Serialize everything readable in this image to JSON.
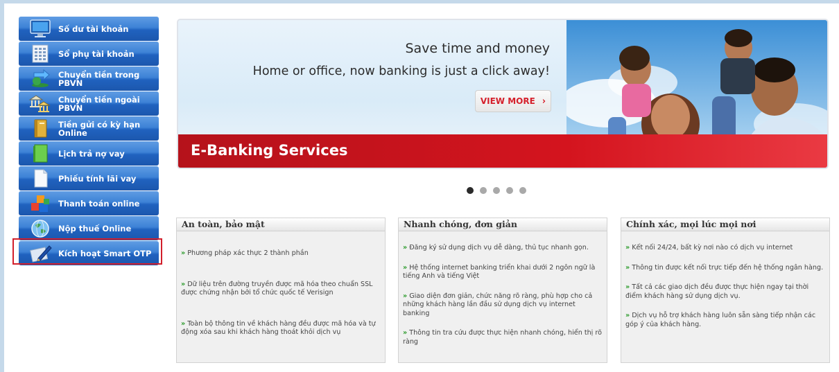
{
  "sidebar": {
    "items": [
      {
        "label": "Số dư tài khoản",
        "icon": "monitor-icon"
      },
      {
        "label": "Sổ phụ tài khoản",
        "icon": "ledger-icon"
      },
      {
        "label": "Chuyển tiền trong PBVN",
        "icon": "transfer-icon"
      },
      {
        "label": "Chuyển tiền ngoài PBVN",
        "icon": "bank-icon"
      },
      {
        "label": "Tiền gửi có kỳ hạn Online",
        "icon": "book-icon"
      },
      {
        "label": "Lịch trả nợ vay",
        "icon": "green-document-icon"
      },
      {
        "label": "Phiếu tính lãi vay",
        "icon": "blank-document-icon"
      },
      {
        "label": "Thanh toán online",
        "icon": "blocks-icon"
      },
      {
        "label": "Nộp thuế Online",
        "icon": "globe-icon"
      },
      {
        "label": "Kích hoạt Smart OTP",
        "icon": "pen-icon"
      }
    ]
  },
  "banner": {
    "headline": "Save time and money",
    "subline": "Home or office, now banking is just a click away!",
    "cta": "VIEW MORE",
    "cta_arrow": "›",
    "section_title": "E-Banking Services"
  },
  "pager": {
    "count": 5,
    "active": 1
  },
  "boxes": [
    {
      "title": "An toàn, bảo mật",
      "items": [
        "Phương pháp xác thực 2 thành phần",
        "Dữ liệu trên đường truyền được mã hóa theo chuẩn SSL được chứng nhận bởi tổ chức quốc tế Verisign",
        "Toàn bộ thông tin về khách hàng đều được mã hóa và tự động xóa sau khi khách hàng thoát khỏi dịch vụ"
      ]
    },
    {
      "title": "Nhanh chóng, đơn giản",
      "items": [
        "Đăng ký sử dụng dịch vụ dễ dàng, thủ tục nhanh gọn.",
        "Hệ thống internet banking triển khai dưới 2 ngôn ngữ là tiếng Anh và tiếng Việt",
        "Giao diện đơn giản, chức năng rõ ràng, phù hợp cho cả những khách hàng lần đầu sử dụng dịch vụ internet banking",
        "Thông tin tra cứu được thực hiện nhanh chóng, hiển thị rõ ràng"
      ]
    },
    {
      "title": "Chính xác, mọi lúc mọi nơi",
      "items": [
        "Kết nối 24/24, bất kỳ nơi nào có dịch vụ internet",
        "Thông tin được kết nối trực tiếp đến hệ thống ngân hàng.",
        "Tất cả các giao dịch đều được thực hiện ngay tại thời điểm khách hàng sử dụng dịch vụ.",
        "Dịch vụ hỗ trợ khách hàng luôn sẵn sàng tiếp nhận các góp ý của khách hàng."
      ]
    }
  ],
  "bullet_glyph": "»",
  "colors": {
    "menu_blue": "#2062bf",
    "banner_red": "#d4141e",
    "highlight_red": "#d21f2b",
    "bullet_green": "#2a9a2a"
  }
}
